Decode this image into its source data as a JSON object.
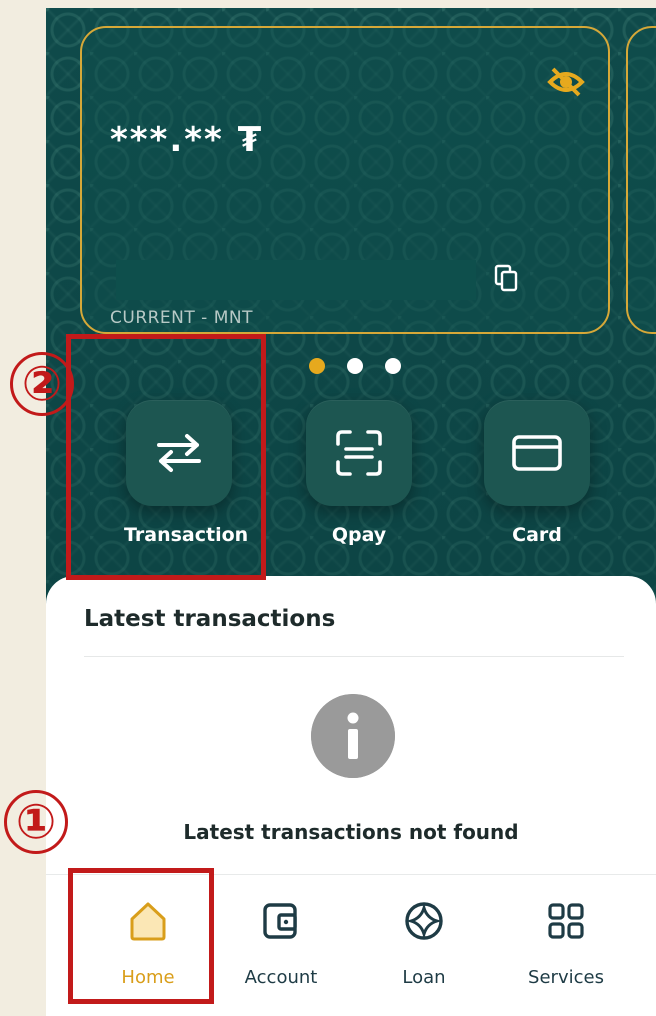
{
  "account_card": {
    "balance": "***.** ₮",
    "account_type": "CURRENT - MNT",
    "icons": {
      "visibility": "eye-off-icon",
      "copy": "copy-icon"
    }
  },
  "carousel": {
    "count": 3,
    "active_index": 0
  },
  "quick_actions": [
    {
      "label": "Transaction",
      "icon": "transfer-arrows-icon"
    },
    {
      "label": "Qpay",
      "icon": "scan-qr-icon"
    },
    {
      "label": "Card",
      "icon": "card-icon"
    }
  ],
  "latest": {
    "title": "Latest transactions",
    "empty_message": "Latest transactions not found",
    "icon": "info-icon"
  },
  "nav": {
    "items": [
      {
        "label": "Home",
        "icon": "home-icon",
        "active": true
      },
      {
        "label": "Account",
        "icon": "wallet-icon",
        "active": false
      },
      {
        "label": "Loan",
        "icon": "loan-icon",
        "active": false
      },
      {
        "label": "Services",
        "icon": "grid-icon",
        "active": false
      }
    ]
  },
  "annotations": {
    "step1": "①",
    "step2": "②"
  },
  "colors": {
    "brand_green": "#0f4a4a",
    "accent_gold": "#d6a838",
    "highlight_red": "#c21a1a"
  }
}
